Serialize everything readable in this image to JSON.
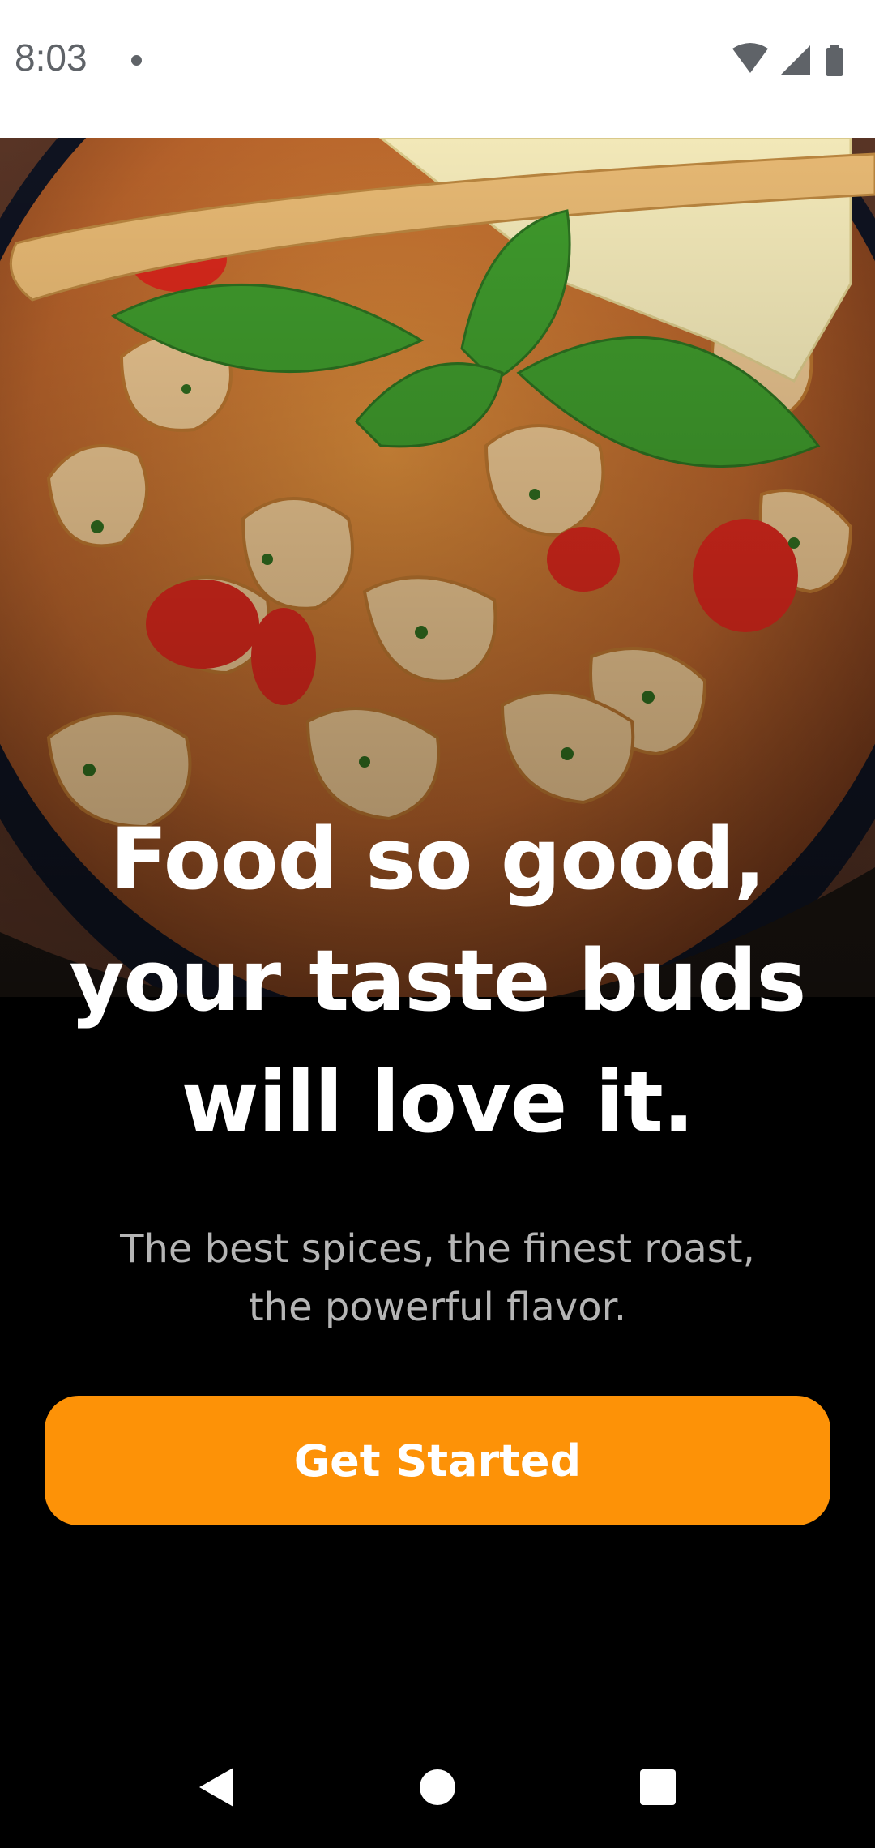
{
  "status_bar": {
    "time": "8:03",
    "icons": [
      "notification-dot-icon",
      "wifi-icon",
      "cell-signal-icon",
      "battery-icon"
    ]
  },
  "hero": {
    "image_description_icon": "food-bowl-image"
  },
  "headline": {
    "line1": "Food so good,",
    "line2": "your taste buds",
    "line3": "will love it."
  },
  "subhead": {
    "line1": "The best spices, the finest roast,",
    "line2": "the powerful flavor."
  },
  "cta": {
    "label": "Get Started",
    "color": "#fd9207"
  },
  "nav_bar": {
    "icons": [
      "back-icon",
      "home-icon",
      "recents-icon"
    ]
  }
}
